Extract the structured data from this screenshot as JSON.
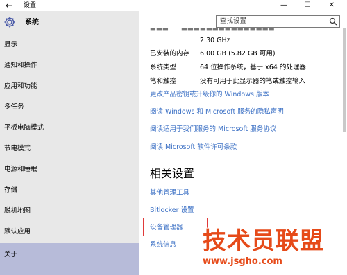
{
  "window": {
    "title": "设置",
    "back_glyph": "←",
    "minimize_glyph": "—",
    "maximize_glyph": "☐",
    "close_glyph": "✕"
  },
  "sidebar": {
    "title": "系统",
    "items": [
      {
        "label": "显示"
      },
      {
        "label": "通知和操作"
      },
      {
        "label": "应用和功能"
      },
      {
        "label": "多任务"
      },
      {
        "label": "平板电脑模式"
      },
      {
        "label": "节电模式"
      },
      {
        "label": "电源和睡眠"
      },
      {
        "label": "存储"
      },
      {
        "label": "脱机地图"
      },
      {
        "label": "默认应用"
      },
      {
        "label": "关于",
        "selected": true
      }
    ]
  },
  "search": {
    "placeholder": "查找设置"
  },
  "about": {
    "cpu_freq": "2.30 GHz",
    "rows": [
      {
        "label": "已安装的内存",
        "value": "6.00 GB (5.82 GB 可用)"
      },
      {
        "label": "系统类型",
        "value": "64 位操作系统，基于 x64 的处理器"
      },
      {
        "label": "笔和触控",
        "value": "没有可用于此显示器的笔或触控输入"
      }
    ],
    "links": [
      "更改产品密钥或升级你的 Windows 版本",
      "阅读 Windows 和 Microsoft 服务的隐私声明",
      "阅读适用于我们服务的 Microsoft 服务协议",
      "阅读 Microsoft 软件许可条款"
    ]
  },
  "related": {
    "title": "相关设置",
    "links": [
      "其他管理工具",
      "Bitlocker 设置",
      "设备管理器",
      "系统信息"
    ]
  },
  "watermark": {
    "text": "技术员联盟",
    "url": "www.jsgho.com"
  },
  "colors": {
    "link": "#3a6fc4",
    "sidebar_bg": "#e8e8e8",
    "selected_bg": "#b7bbd9",
    "highlight_border": "#e03a3a",
    "watermark": "#e64a19"
  }
}
